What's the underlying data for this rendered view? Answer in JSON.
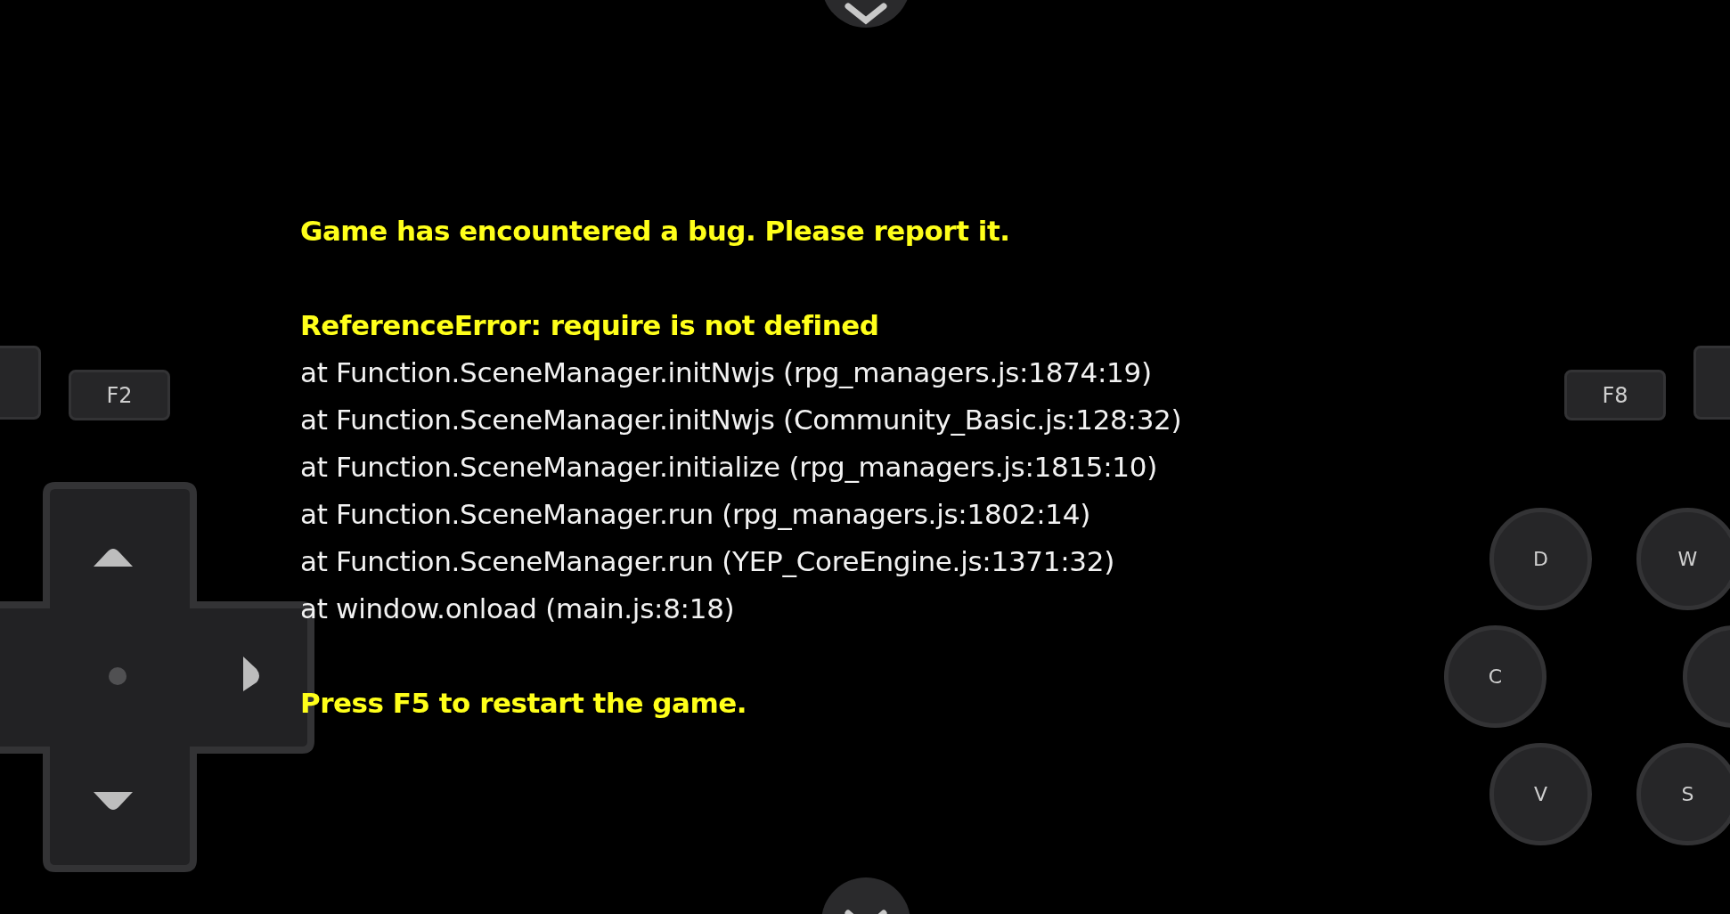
{
  "message": [
    {
      "kind": "title",
      "text": "Game has encountered a bug. Please report it."
    },
    {
      "kind": "gap"
    },
    {
      "kind": "error",
      "text": "ReferenceError: require is not defined"
    },
    {
      "kind": "stack",
      "text": "at Function.SceneManager.initNwjs (rpg_managers.js:1874:19)"
    },
    {
      "kind": "stack",
      "text": "at Function.SceneManager.initNwjs (Community_Basic.js:128:32)"
    },
    {
      "kind": "stack",
      "text": "at Function.SceneManager.initialize (rpg_managers.js:1815:10)"
    },
    {
      "kind": "stack",
      "text": "at Function.SceneManager.run (rpg_managers.js:1802:14)"
    },
    {
      "kind": "stack",
      "text": "at Function.SceneManager.run (YEP_CoreEngine.js:1371:32)"
    },
    {
      "kind": "stack",
      "text": "at window.onload (main.js:8:18)"
    },
    {
      "kind": "gap"
    },
    {
      "kind": "hint",
      "text": "Press F5 to restart the game."
    }
  ],
  "function_keys": [
    {
      "label": "F2"
    },
    {
      "label": "F8"
    }
  ],
  "action_buttons": [
    {
      "label": "D"
    },
    {
      "label": "W"
    },
    {
      "label": "C"
    },
    {
      "label": "V"
    },
    {
      "label": "S"
    }
  ]
}
